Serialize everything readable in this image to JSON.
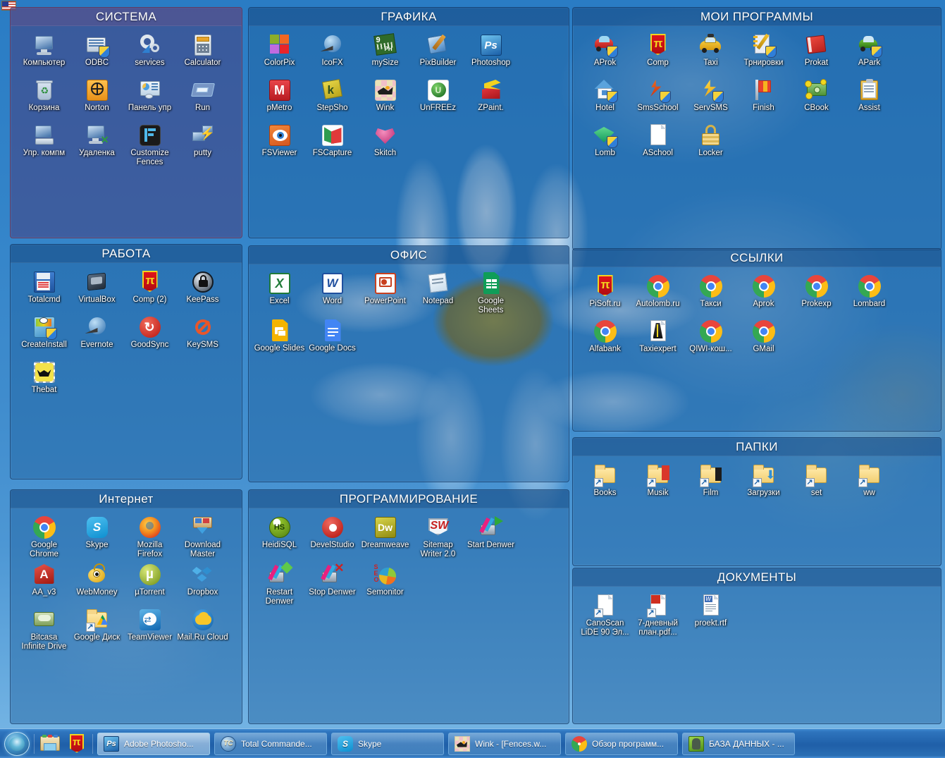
{
  "desktop": {
    "lang_indicator": "us-flag-icon",
    "wallpaper": "blue-sky-daisy-flower"
  },
  "fences": [
    {
      "id": "sistema",
      "title": "СИСТЕМА",
      "accent": "#5c528c",
      "icons": [
        {
          "label": "Компьютер",
          "icon": "computer-icon"
        },
        {
          "label": "ODBC",
          "icon": "odbc-icon"
        },
        {
          "label": "services",
          "icon": "gear-icon"
        },
        {
          "label": "Calculator",
          "icon": "calculator-icon"
        },
        {
          "label": "Корзина",
          "icon": "recycle-bin-icon"
        },
        {
          "label": "Norton",
          "icon": "norton-globe-icon"
        },
        {
          "label": "Панель упр",
          "icon": "control-panel-icon"
        },
        {
          "label": "Run",
          "icon": "run-icon"
        },
        {
          "label": "Упр. компм",
          "icon": "computer-management-icon"
        },
        {
          "label": "Удаленка",
          "icon": "remote-desktop-icon"
        },
        {
          "label": "Customize Fences",
          "icon": "fences-icon"
        },
        {
          "label": "putty",
          "icon": "putty-icon"
        }
      ]
    },
    {
      "id": "grafika",
      "title": "ГРАФИКА",
      "accent": "#1f609e",
      "icons": [
        {
          "label": "ColorPix",
          "icon": "colorpix-icon"
        },
        {
          "label": "IcoFX",
          "icon": "icofx-icon"
        },
        {
          "label": "mySize",
          "icon": "mysize-ruler-icon"
        },
        {
          "label": "PixBuilder",
          "icon": "pixbuilder-icon"
        },
        {
          "label": "Photoshop",
          "icon": "photoshop-icon"
        },
        {
          "label": "pMetro",
          "icon": "pmetro-icon"
        },
        {
          "label": "StepSho",
          "icon": "stepshot-icon"
        },
        {
          "label": "Wink",
          "icon": "wink-icon"
        },
        {
          "label": "UnFREEz",
          "icon": "unfreez-icon"
        },
        {
          "label": "ZPaint.",
          "icon": "zpaint-icon"
        },
        {
          "label": "FSViewer",
          "icon": "fastone-viewer-icon"
        },
        {
          "label": "FSCapture",
          "icon": "fastone-capture-icon"
        },
        {
          "label": "Skitch",
          "icon": "skitch-icon"
        }
      ]
    },
    {
      "id": "moi-programmy",
      "title": "МОИ ПРОГРАММЫ",
      "accent": "#1f609e",
      "icons": [
        {
          "label": "AProk",
          "icon": "red-car-shield-icon"
        },
        {
          "label": "Comp",
          "icon": "pi-shield-icon"
        },
        {
          "label": "Taxi",
          "icon": "taxi-car-icon"
        },
        {
          "label": "Трнировки",
          "icon": "notebook-pencil-shield-icon"
        },
        {
          "label": "Prokat",
          "icon": "red-book-icon"
        },
        {
          "label": "APark",
          "icon": "green-car-shield-icon"
        },
        {
          "label": "Hotel",
          "icon": "house-shield-icon"
        },
        {
          "label": "SmsSchool",
          "icon": "sms-lightning-shield-icon"
        },
        {
          "label": "ServSMS",
          "icon": "lightning-shield-icon"
        },
        {
          "label": "Finish",
          "icon": "flag-icon"
        },
        {
          "label": "CBook",
          "icon": "money-icon"
        },
        {
          "label": "Assist",
          "icon": "clipboard-icon"
        },
        {
          "label": "Lomb",
          "icon": "gem-shield-icon"
        },
        {
          "label": "ASchool",
          "icon": "blank-document-icon"
        },
        {
          "label": "Locker",
          "icon": "padlock-icon"
        }
      ]
    },
    {
      "id": "rabota",
      "title": "РАБОТА",
      "accent": "#1f609e",
      "icons": [
        {
          "label": "Totalcmd",
          "icon": "total-commander-icon"
        },
        {
          "label": "VirtualBox",
          "icon": "virtualbox-icon"
        },
        {
          "label": "Comp (2)",
          "icon": "pi-shield-icon"
        },
        {
          "label": "KeePass",
          "icon": "keepass-lock-icon"
        },
        {
          "label": "CreateInstall",
          "icon": "createinstall-icon"
        },
        {
          "label": "Evernote",
          "icon": "evernote-icon"
        },
        {
          "label": "GoodSync",
          "icon": "goodsync-icon"
        },
        {
          "label": "KeySMS",
          "icon": "no-entry-icon"
        },
        {
          "label": "Thebat",
          "icon": "thebat-icon"
        }
      ]
    },
    {
      "id": "ofis",
      "title": "ОФИС",
      "accent": "#1f609e",
      "icons": [
        {
          "label": "Excel",
          "icon": "excel-icon"
        },
        {
          "label": "Word",
          "icon": "word-icon"
        },
        {
          "label": "PowerPoint",
          "icon": "powerpoint-icon"
        },
        {
          "label": "Notepad",
          "icon": "notepad-icon"
        },
        {
          "label": "Google Sheets",
          "icon": "google-sheets-icon"
        },
        {
          "label": "Google Slides",
          "icon": "google-slides-icon"
        },
        {
          "label": "Google Docs",
          "icon": "google-docs-icon"
        }
      ]
    },
    {
      "id": "ssylki",
      "title": "ССЫЛКИ",
      "accent": "#1f609e",
      "icons": [
        {
          "label": "PiSoft.ru",
          "icon": "pi-shield-icon"
        },
        {
          "label": "Autolomb.ru",
          "icon": "chrome-icon"
        },
        {
          "label": "Такси",
          "icon": "chrome-icon"
        },
        {
          "label": "Aprok",
          "icon": "chrome-icon"
        },
        {
          "label": "Prokexp",
          "icon": "chrome-icon"
        },
        {
          "label": "Lombard",
          "icon": "chrome-icon"
        },
        {
          "label": "Alfabank",
          "icon": "chrome-icon"
        },
        {
          "label": "Taxiexpert",
          "icon": "taxiexpert-doc-icon"
        },
        {
          "label": "QIWI-кош...",
          "icon": "chrome-icon"
        },
        {
          "label": "GMail",
          "icon": "chrome-icon"
        }
      ]
    },
    {
      "id": "papki",
      "title": "ПАПКИ",
      "accent": "#1f609e",
      "icons": [
        {
          "label": "Books",
          "icon": "folder-shortcut-icon"
        },
        {
          "label": "Musik",
          "icon": "folder-music-shortcut-icon"
        },
        {
          "label": "Film",
          "icon": "folder-film-shortcut-icon"
        },
        {
          "label": "Загрузки",
          "icon": "folder-downloads-shortcut-icon"
        },
        {
          "label": "set",
          "icon": "folder-shortcut-icon"
        },
        {
          "label": "ww",
          "icon": "folder-shortcut-icon"
        }
      ]
    },
    {
      "id": "dokumenty",
      "title": "ДОКУМЕНТЫ",
      "accent": "#1f609e",
      "icons": [
        {
          "label": "CanoScan LiDE 90 Эл...",
          "icon": "document-shortcut-icon"
        },
        {
          "label": "7-дневный план.pdf...",
          "icon": "pdf-shortcut-icon"
        },
        {
          "label": "proekt.rtf",
          "icon": "rtf-document-icon"
        }
      ]
    },
    {
      "id": "internet",
      "title": "Интернет",
      "accent": "#1f609e",
      "icons": [
        {
          "label": "Google Chrome",
          "icon": "chrome-icon"
        },
        {
          "label": "Skype",
          "icon": "skype-icon"
        },
        {
          "label": "Mozilla Firefox",
          "icon": "firefox-icon"
        },
        {
          "label": "Download Master",
          "icon": "download-master-icon"
        },
        {
          "label": "AA_v3",
          "icon": "aa-v3-icon"
        },
        {
          "label": "WebMoney",
          "icon": "webmoney-icon"
        },
        {
          "label": "µTorrent",
          "icon": "utorrent-icon"
        },
        {
          "label": "Dropbox",
          "icon": "dropbox-icon"
        },
        {
          "label": "Bitcasa Infinite Drive",
          "icon": "bitcasa-icon"
        },
        {
          "label": "Google Диск",
          "icon": "google-drive-folder-icon"
        },
        {
          "label": "TeamViewer",
          "icon": "teamviewer-icon"
        },
        {
          "label": "Mail.Ru Cloud",
          "icon": "mailru-cloud-icon"
        }
      ]
    },
    {
      "id": "programmirovanie",
      "title": "ПРОГРАММИРОВАНИЕ",
      "accent": "#1f609e",
      "icons": [
        {
          "label": "HeidiSQL",
          "icon": "heidisql-icon"
        },
        {
          "label": "DevelStudio",
          "icon": "develstudio-icon"
        },
        {
          "label": "Dreamweave",
          "icon": "dreamweaver-icon"
        },
        {
          "label": "Sitemap Writer 2.0",
          "icon": "sitemap-writer-icon"
        },
        {
          "label": "Start Denwer",
          "icon": "denwer-start-icon"
        },
        {
          "label": "Restart Denwer",
          "icon": "denwer-restart-icon"
        },
        {
          "label": "Stop Denwer",
          "icon": "denwer-stop-icon"
        },
        {
          "label": "Semonitor",
          "icon": "semonitor-icon"
        }
      ]
    }
  ],
  "taskbar": {
    "start_label": "start-orb",
    "quick_launch": [
      {
        "label": "Проводник",
        "icon": "explorer-folder-icon"
      },
      {
        "label": "PiSoft",
        "icon": "pi-shield-icon"
      }
    ],
    "buttons": [
      {
        "label": "Adobe Photosho...",
        "icon": "photoshop-icon",
        "active": true
      },
      {
        "label": "Total Commande...",
        "icon": "total-commander-globe-icon",
        "active": false
      },
      {
        "label": "Skype",
        "icon": "skype-icon",
        "active": false
      },
      {
        "label": "Wink - [Fences.w...",
        "icon": "wink-icon",
        "active": false
      },
      {
        "label": "Обзор программ...",
        "icon": "chrome-icon",
        "active": false
      },
      {
        "label": "БАЗА ДАННЫХ - ...",
        "icon": "evernote-green-icon",
        "active": false
      }
    ]
  }
}
